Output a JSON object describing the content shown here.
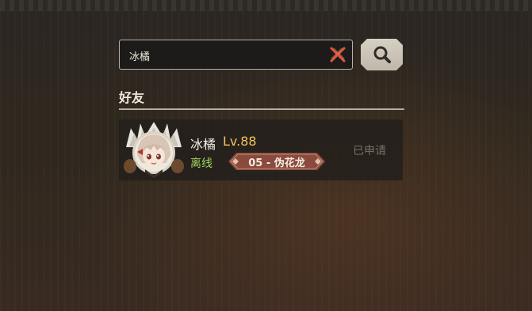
{
  "search": {
    "value": "冰橘",
    "clear_icon": "close-x-icon",
    "search_icon": "magnifier-icon"
  },
  "friends_section": {
    "title": "好友"
  },
  "friend": {
    "name": "冰橘",
    "level": "Lv.88",
    "status": "离线",
    "world": "05 - 伪花龙",
    "request_state": "已申请",
    "avatar_icon": "character-portrait-avatar"
  },
  "colors": {
    "level": "#f1c35a",
    "status_offline": "#9fd55e",
    "badge": "#8a4a3e",
    "clear_icon": "#e0573f",
    "search_button": "#cfc9bc"
  }
}
